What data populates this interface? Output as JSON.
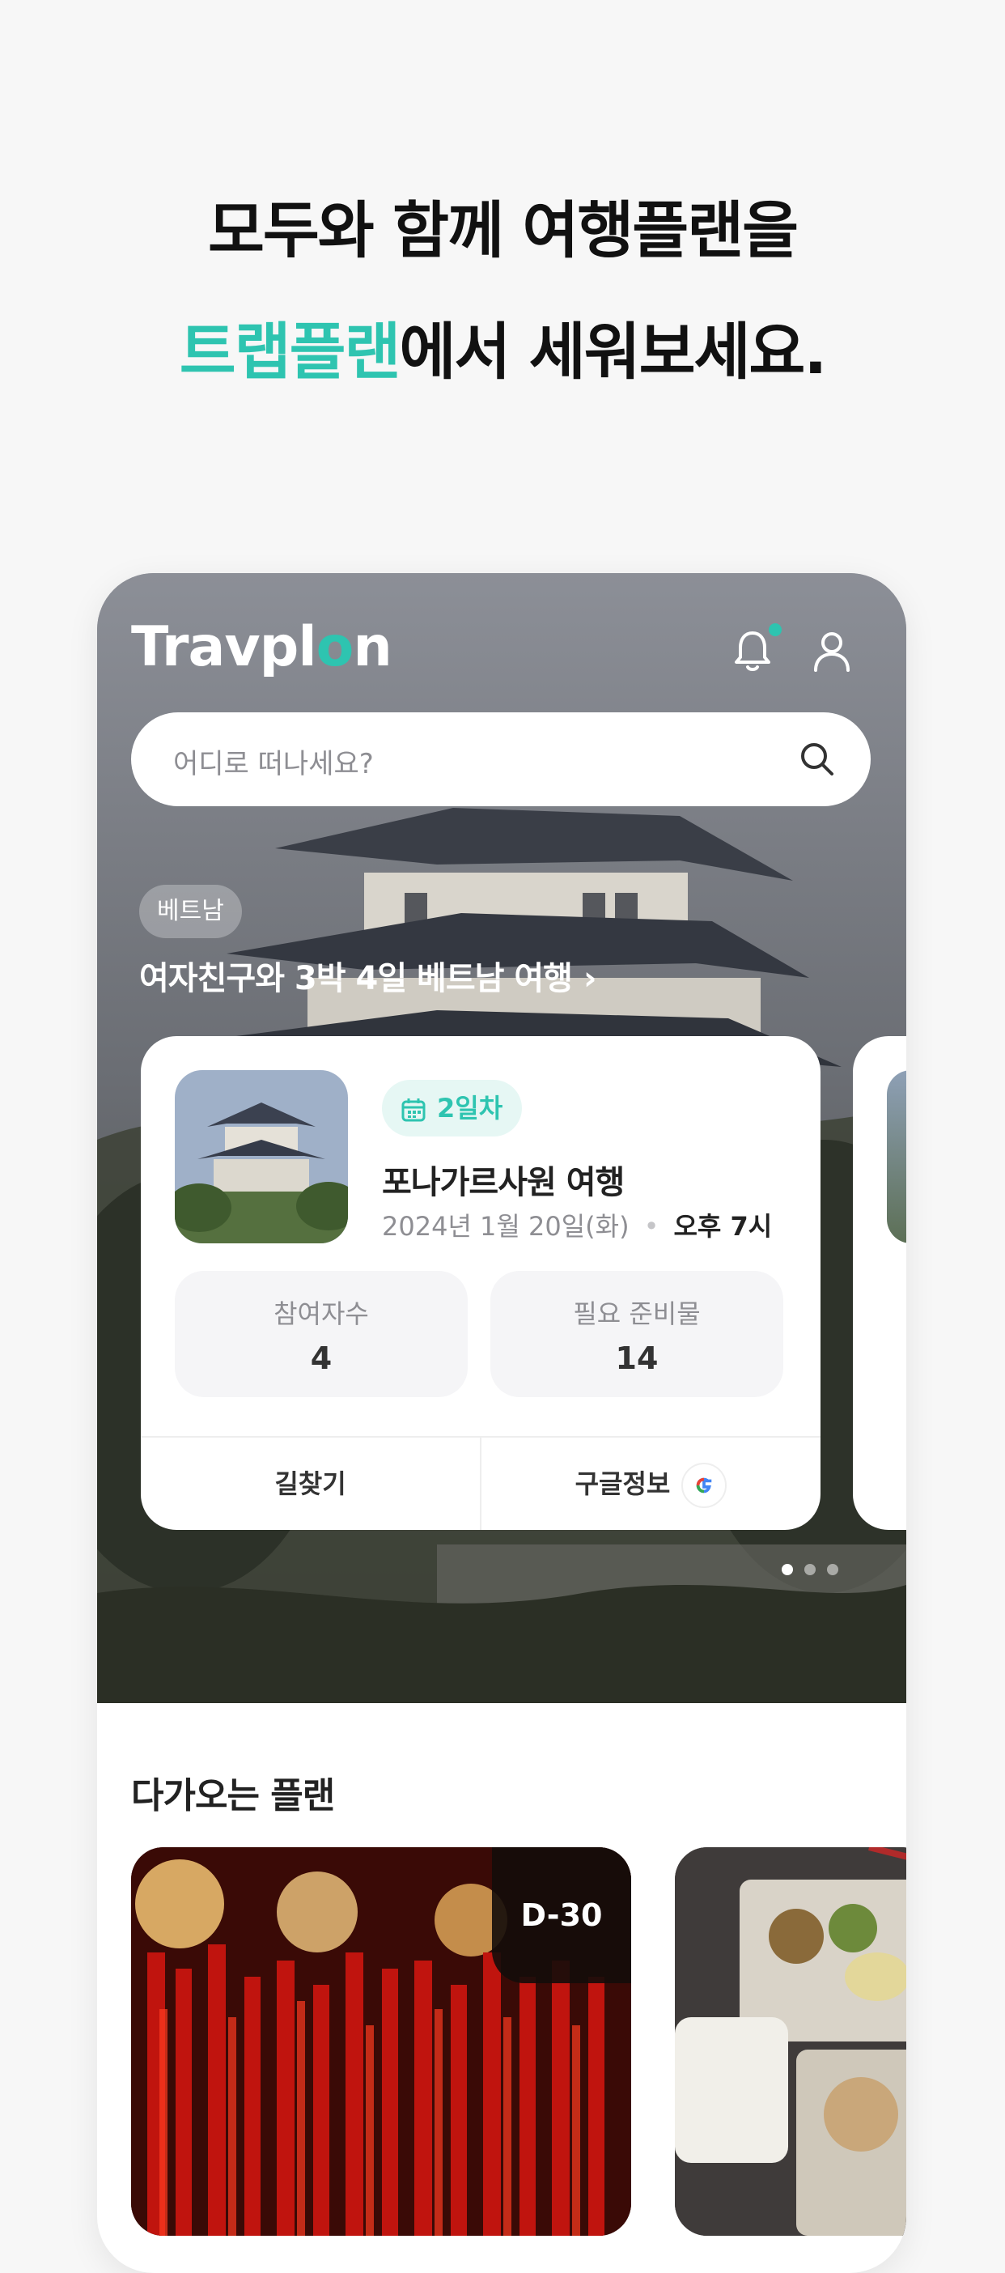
{
  "headline": {
    "line1": "모두와 함께 여행플랜을",
    "accent": "트랩플랜",
    "line2_rest": "에서 세워보세요."
  },
  "app": {
    "logo_prefix": "Travpl",
    "logo_pin": "o",
    "logo_suffix": "n",
    "colors": {
      "accent": "#2ec4b0",
      "notification_dot": "#2ec4b0"
    },
    "icons": [
      "bell-icon",
      "user-icon",
      "search-icon",
      "chevron-right-icon",
      "calendar-icon",
      "google-icon"
    ],
    "search": {
      "placeholder": "어디로 떠나세요?"
    },
    "featured": {
      "tag": "베트남",
      "title": "여자친구와 3박 4일 베트남 여행",
      "chevron": "›"
    },
    "card": {
      "day_badge": "2일차",
      "plan_name": "포나가르사원 여행",
      "date": "2024년 1월 20일(화)",
      "dot": "•",
      "time": "오후 7시",
      "stats": [
        {
          "label": "참여자수",
          "value": "4"
        },
        {
          "label": "필요 준비물",
          "value": "14"
        }
      ],
      "actions": {
        "directions": "길찾기",
        "google_info": "구글정보"
      }
    },
    "pager": {
      "pages": 3,
      "active": 1
    },
    "upcoming": {
      "title": "다가오는 플랜",
      "dday": "D-30"
    }
  }
}
